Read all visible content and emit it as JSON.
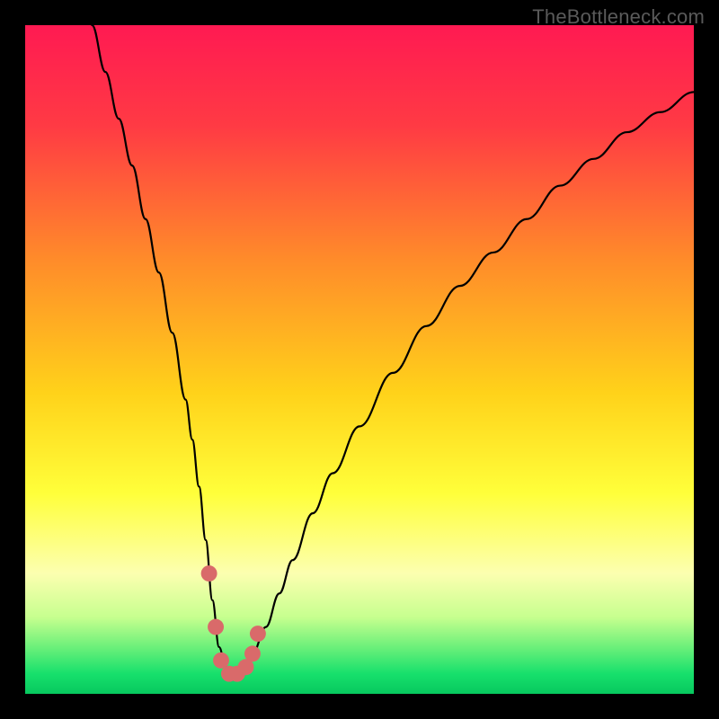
{
  "watermark": "TheBottleneck.com",
  "chart_data": {
    "type": "line",
    "title": "",
    "xlabel": "",
    "ylabel": "",
    "xlim": [
      0,
      100
    ],
    "ylim": [
      0,
      100
    ],
    "grid": false,
    "legend": false,
    "gradient_stops": [
      {
        "offset": 0.0,
        "color": "#ff1a52"
      },
      {
        "offset": 0.15,
        "color": "#ff3a44"
      },
      {
        "offset": 0.35,
        "color": "#ff8b2a"
      },
      {
        "offset": 0.55,
        "color": "#ffd21a"
      },
      {
        "offset": 0.7,
        "color": "#ffff3a"
      },
      {
        "offset": 0.82,
        "color": "#fcffb0"
      },
      {
        "offset": 0.885,
        "color": "#c7ff8f"
      },
      {
        "offset": 0.93,
        "color": "#6cf07a"
      },
      {
        "offset": 0.97,
        "color": "#17e06c"
      },
      {
        "offset": 1.0,
        "color": "#07c85e"
      }
    ],
    "series": [
      {
        "name": "bottleneck-curve",
        "stroke": "#000000",
        "stroke_width": 2.2,
        "x": [
          10,
          12,
          14,
          16,
          18,
          20,
          22,
          24,
          25,
          26,
          27,
          28,
          29,
          30,
          31,
          32,
          33,
          34,
          36,
          38,
          40,
          43,
          46,
          50,
          55,
          60,
          65,
          70,
          75,
          80,
          85,
          90,
          95,
          100
        ],
        "y": [
          100,
          93,
          86,
          79,
          71,
          63,
          54,
          44,
          38,
          31,
          23,
          14,
          7,
          4,
          3,
          3,
          4,
          6,
          10,
          15,
          20,
          27,
          33,
          40,
          48,
          55,
          61,
          66,
          71,
          76,
          80,
          84,
          87,
          90
        ]
      }
    ],
    "markers": {
      "name": "highlight-segment",
      "color": "#d96a6a",
      "radius": 2.8,
      "x": [
        27.5,
        28.5,
        29.3,
        30.5,
        31.7,
        33.0,
        34.0,
        34.8
      ],
      "y": [
        18,
        10,
        5,
        3,
        3,
        4,
        6,
        9
      ]
    }
  }
}
